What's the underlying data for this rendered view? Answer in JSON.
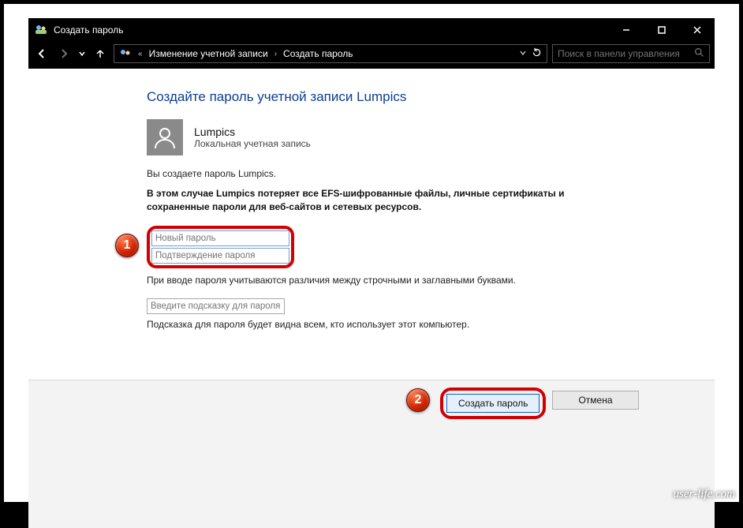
{
  "titlebar": {
    "title": "Создать пароль"
  },
  "addr": {
    "back": true,
    "forward_disabled": true,
    "segments": [
      "Изменение учетной записи",
      "Создать пароль"
    ]
  },
  "search": {
    "placeholder": "Поиск в панели управления"
  },
  "page": {
    "heading": "Создайте пароль учетной записи Lumpics",
    "username": "Lumpics",
    "account_type": "Локальная учетная запись",
    "creating_text": "Вы создаете пароль Lumpics.",
    "warning": "В этом случае Lumpics потеряет все EFS-шифрованные файлы, личные сертификаты и сохраненные пароли для веб-сайтов и сетевых ресурсов.",
    "new_password_placeholder": "Новый пароль",
    "confirm_password_placeholder": "Подтверждение пароля",
    "case_note": "При вводе пароля учитываются различия между строчными и заглавными буквами.",
    "hint_placeholder": "Введите подсказку для пароля",
    "hint_note": "Подсказка для пароля будет видна всем, кто использует этот компьютер."
  },
  "buttons": {
    "create": "Создать пароль",
    "cancel": "Отмена"
  },
  "annotations": {
    "step1": "1",
    "step2": "2"
  },
  "watermark": "user-life.com"
}
